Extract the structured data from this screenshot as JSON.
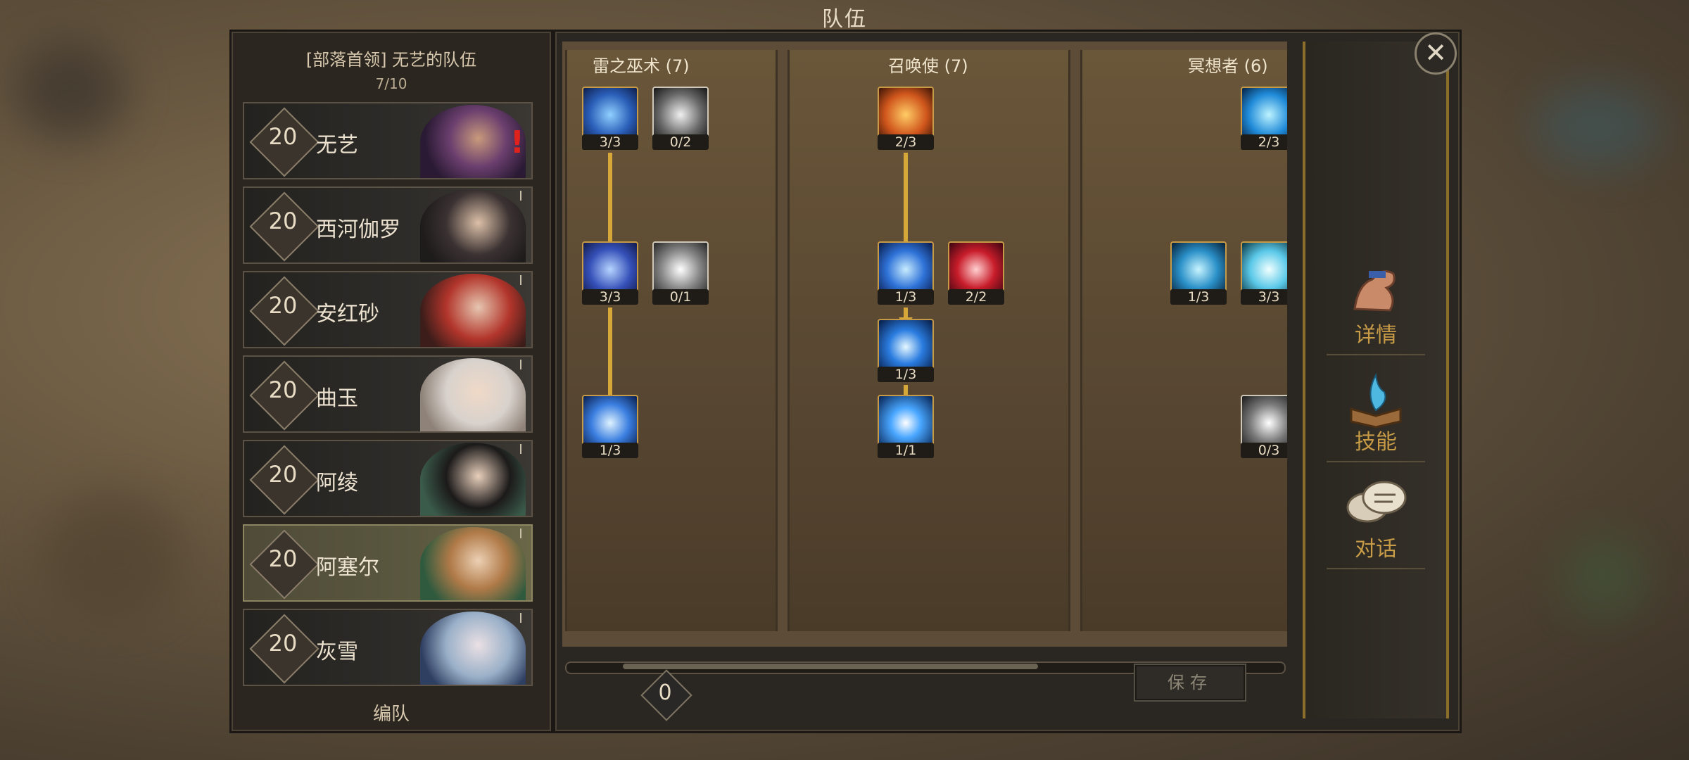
{
  "window": {
    "title": "队伍"
  },
  "team": {
    "title": "[部落首领] 无艺的队伍",
    "count": "7/10",
    "footer": "编队",
    "members": [
      {
        "level": "20",
        "name": "无艺",
        "alert": "!"
      },
      {
        "level": "20",
        "name": "西河伽罗"
      },
      {
        "level": "20",
        "name": "安红砂"
      },
      {
        "level": "20",
        "name": "曲玉"
      },
      {
        "level": "20",
        "name": "阿绫"
      },
      {
        "level": "20",
        "name": "阿塞尔",
        "selected": true
      },
      {
        "level": "20",
        "name": "灰雪"
      }
    ]
  },
  "skills": {
    "columns": [
      {
        "header": "雷之巫术 (7)"
      },
      {
        "header": "召唤使 (7)"
      },
      {
        "header": "冥想者 (6)"
      }
    ],
    "nodes": {
      "c1a": "3/3",
      "c1b": "0/2",
      "c1c": "3/3",
      "c1d": "0/1",
      "c1e": "1/3",
      "c2a": "2/3",
      "c2b": "1/3",
      "c2c": "2/2",
      "c2d": "1/3",
      "c2e": "1/1",
      "c3a": "2/3",
      "c3b": "1/3",
      "c3c": "3/3",
      "c3d": "0/3"
    },
    "points": "0",
    "save_label": "保存"
  },
  "nav": {
    "details": "详情",
    "skills": "技能",
    "dialogue": "对话"
  },
  "colors": {
    "accent": "#c89c46",
    "arrow": "#d6a83a",
    "alert": "#e0221c"
  }
}
